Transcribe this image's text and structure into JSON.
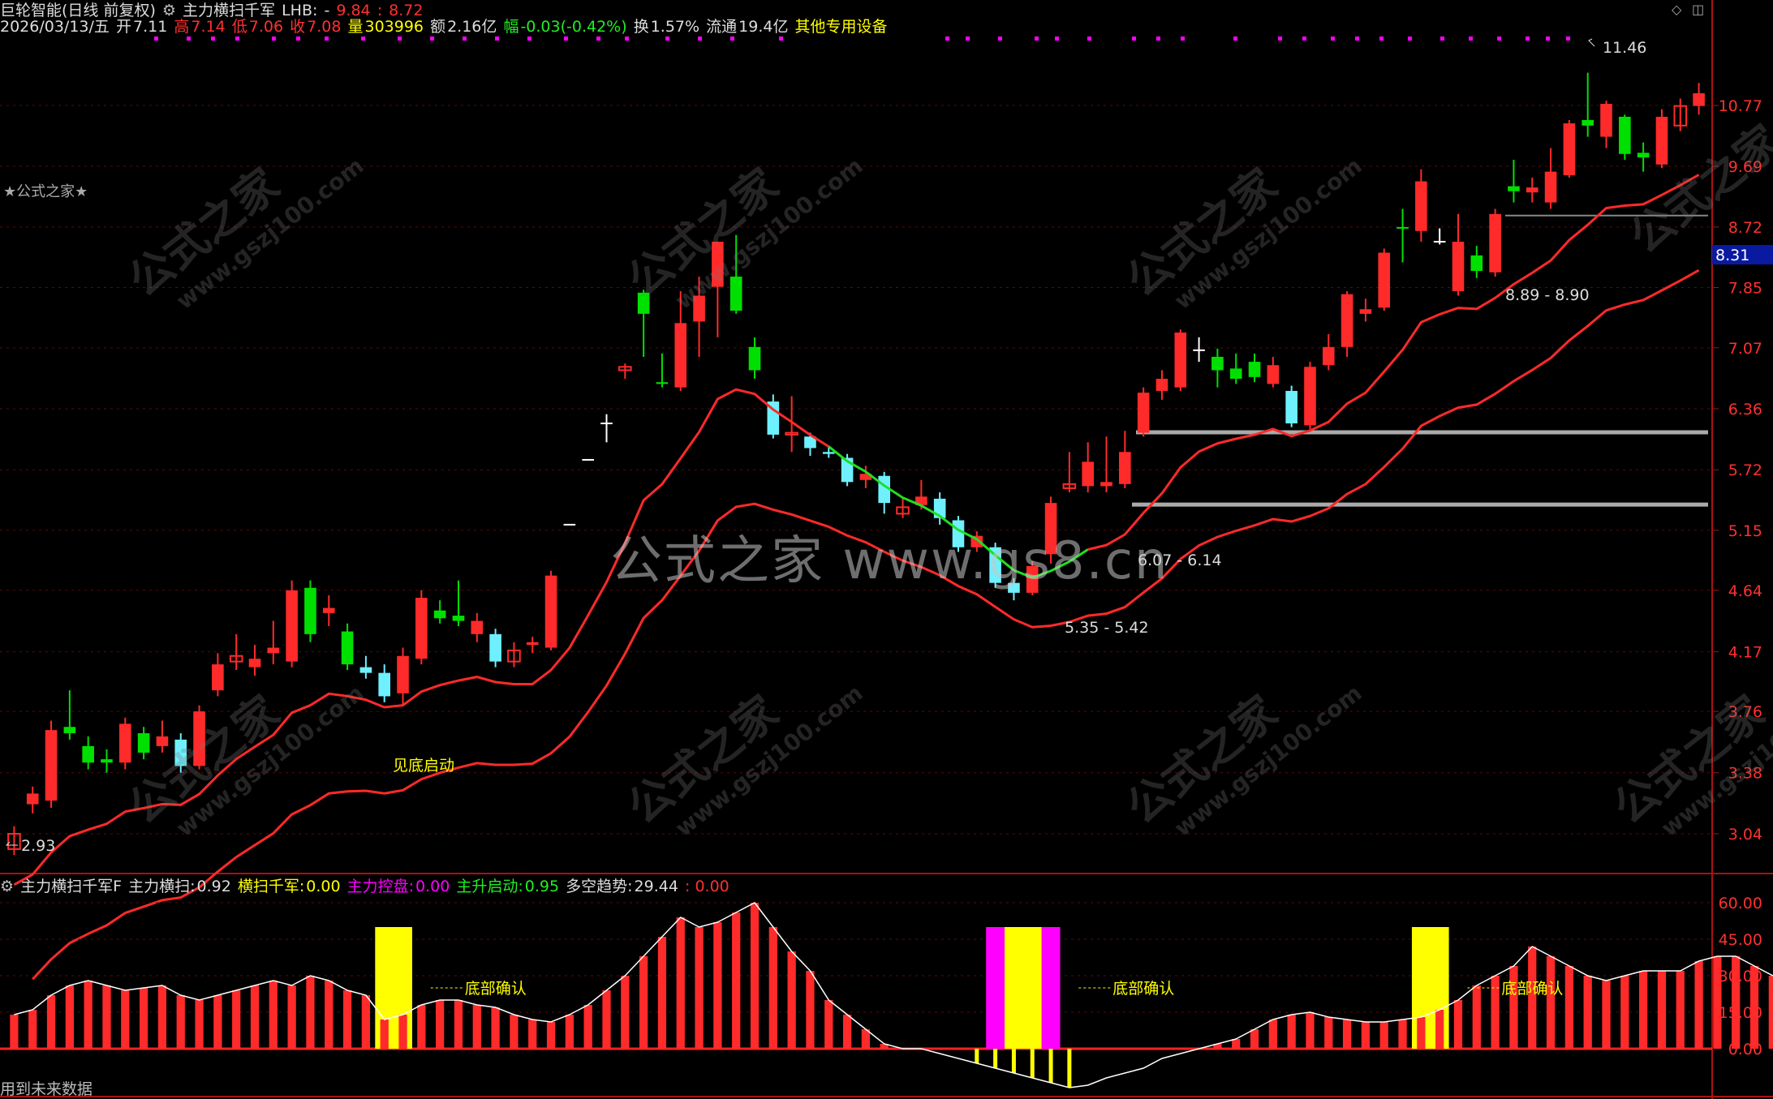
{
  "header": {
    "app": "巨轮智能(日线 前复权)",
    "indicator": "主力横扫千军",
    "lhb_label": "LHB:",
    "lhb_dash": "-",
    "range_a": "9.84",
    "range_b": "8.72"
  },
  "quote": {
    "date": "2026/03/13/五",
    "open_label": "开",
    "open": "7.11",
    "high_label": "高",
    "high": "7.14",
    "low_label": "低",
    "low": "7.06",
    "close_label": "收",
    "close": "7.08",
    "volume_label": "量",
    "volume": "303996",
    "amount_label": "额",
    "amount": "2.16亿",
    "change_label": "幅",
    "change": "-0.03(-0.42%)",
    "turnover_label": "换",
    "turnover": "1.57%",
    "float_label": "流通",
    "float": "19.4亿",
    "device": "其他专用设备"
  },
  "side_tag": "★公式之家★",
  "watermark": {
    "center": "公式之家 www.gs8.cn",
    "brand": "公式之家",
    "url": "www.gszj100.com"
  },
  "price_axis": [
    "10.77",
    "9.69",
    "8.72",
    "7.85",
    "7.07",
    "6.36",
    "5.72",
    "5.15",
    "4.64",
    "4.17",
    "3.76",
    "3.38",
    "3.04"
  ],
  "current_price": "8.31",
  "annotations": {
    "high_mark": "11.46",
    "low_mark": "2.93",
    "zone1": "8.89 - 8.90",
    "zone2": "6.07 - 6.14",
    "zone3": "5.35 - 5.42",
    "signal": "见底启动",
    "bottom_confirm": "底部确认"
  },
  "lower": {
    "title": "主力横扫千军F",
    "l1": "主力横扫:",
    "v1": "0.92",
    "l2": "横扫千军:",
    "v2": "0.00",
    "l3": "主力控盘:",
    "v3": "0.00",
    "l4": "主升启动:",
    "v4": "0.95",
    "l5": "多空趋势:",
    "v5": "29.44",
    "v6": ": 0.00",
    "axis": [
      "60.00",
      "45.00",
      "30.00",
      "15.00",
      "0.00"
    ]
  },
  "footer": "用到未来数据",
  "colors": {
    "up": "#ff2a2a",
    "down_a": "#00e000",
    "down_b": "#6ef0ff",
    "yellow": "#ffff00",
    "magenta": "#ff00ff",
    "green_line": "#22dd22"
  },
  "chart_data": {
    "type": "candlestick",
    "candles": [
      {
        "o": 3.04,
        "c": 2.96,
        "h": 3.08,
        "l": 2.93,
        "k": "r"
      },
      {
        "o": 3.2,
        "c": 3.26,
        "h": 3.3,
        "l": 3.15,
        "k": "r"
      },
      {
        "o": 3.22,
        "c": 3.64,
        "h": 3.7,
        "l": 3.18,
        "k": "r"
      },
      {
        "o": 3.66,
        "c": 3.62,
        "h": 3.9,
        "l": 3.58,
        "k": "g"
      },
      {
        "o": 3.54,
        "c": 3.44,
        "h": 3.6,
        "l": 3.4,
        "k": "g"
      },
      {
        "o": 3.44,
        "c": 3.46,
        "h": 3.52,
        "l": 3.38,
        "k": "g"
      },
      {
        "o": 3.44,
        "c": 3.68,
        "h": 3.72,
        "l": 3.4,
        "k": "r"
      },
      {
        "o": 3.62,
        "c": 3.5,
        "h": 3.66,
        "l": 3.46,
        "k": "g"
      },
      {
        "o": 3.6,
        "c": 3.54,
        "h": 3.7,
        "l": 3.5,
        "k": "r"
      },
      {
        "o": 3.58,
        "c": 3.42,
        "h": 3.62,
        "l": 3.38,
        "k": "c"
      },
      {
        "o": 3.42,
        "c": 3.76,
        "h": 3.8,
        "l": 3.4,
        "k": "r"
      },
      {
        "o": 3.9,
        "c": 4.08,
        "h": 4.16,
        "l": 3.86,
        "k": "r"
      },
      {
        "o": 4.1,
        "c": 4.14,
        "h": 4.3,
        "l": 4.04,
        "k": "r"
      },
      {
        "o": 4.06,
        "c": 4.12,
        "h": 4.22,
        "l": 4.0,
        "k": "r"
      },
      {
        "o": 4.16,
        "c": 4.2,
        "h": 4.4,
        "l": 4.08,
        "k": "r"
      },
      {
        "o": 4.1,
        "c": 4.64,
        "h": 4.72,
        "l": 4.06,
        "k": "r"
      },
      {
        "o": 4.66,
        "c": 4.3,
        "h": 4.72,
        "l": 4.24,
        "k": "g"
      },
      {
        "o": 4.46,
        "c": 4.5,
        "h": 4.6,
        "l": 4.36,
        "k": "r"
      },
      {
        "o": 4.32,
        "c": 4.08,
        "h": 4.38,
        "l": 4.04,
        "k": "g"
      },
      {
        "o": 4.06,
        "c": 4.02,
        "h": 4.14,
        "l": 3.98,
        "k": "c"
      },
      {
        "o": 4.02,
        "c": 3.86,
        "h": 4.08,
        "l": 3.82,
        "k": "c"
      },
      {
        "o": 3.88,
        "c": 4.14,
        "h": 4.2,
        "l": 3.8,
        "k": "r"
      },
      {
        "o": 4.12,
        "c": 4.58,
        "h": 4.64,
        "l": 4.08,
        "k": "r"
      },
      {
        "o": 4.48,
        "c": 4.42,
        "h": 4.56,
        "l": 4.38,
        "k": "g"
      },
      {
        "o": 4.44,
        "c": 4.4,
        "h": 4.72,
        "l": 4.36,
        "k": "g"
      },
      {
        "o": 4.3,
        "c": 4.4,
        "h": 4.46,
        "l": 4.24,
        "k": "r"
      },
      {
        "o": 4.3,
        "c": 4.1,
        "h": 4.34,
        "l": 4.06,
        "k": "c"
      },
      {
        "o": 4.1,
        "c": 4.18,
        "h": 4.24,
        "l": 4.06,
        "k": "r"
      },
      {
        "o": 4.22,
        "c": 4.24,
        "h": 4.28,
        "l": 4.16,
        "k": "r"
      },
      {
        "o": 4.2,
        "c": 4.76,
        "h": 4.8,
        "l": 4.18,
        "k": "r"
      },
      {
        "o": 5.2,
        "c": 5.2,
        "h": 5.2,
        "l": 5.2,
        "k": "w"
      },
      {
        "o": 5.82,
        "c": 5.82,
        "h": 5.82,
        "l": 5.82,
        "k": "w"
      },
      {
        "o": 6.2,
        "c": 6.2,
        "h": 6.3,
        "l": 6.0,
        "k": "w"
      },
      {
        "o": 6.8,
        "c": 6.84,
        "h": 6.88,
        "l": 6.7,
        "k": "r"
      },
      {
        "o": 7.78,
        "c": 7.5,
        "h": 7.82,
        "l": 6.96,
        "k": "g"
      },
      {
        "o": 6.64,
        "c": 6.66,
        "h": 7.0,
        "l": 6.6,
        "k": "g"
      },
      {
        "o": 6.6,
        "c": 7.38,
        "h": 7.8,
        "l": 6.56,
        "k": "r"
      },
      {
        "o": 7.4,
        "c": 7.74,
        "h": 8.0,
        "l": 6.96,
        "k": "r"
      },
      {
        "o": 7.86,
        "c": 8.5,
        "h": 8.5,
        "l": 7.2,
        "k": "r"
      },
      {
        "o": 8.0,
        "c": 7.54,
        "h": 8.6,
        "l": 7.5,
        "k": "g"
      },
      {
        "o": 7.08,
        "c": 6.8,
        "h": 7.2,
        "l": 6.7,
        "k": "g"
      },
      {
        "o": 6.44,
        "c": 6.08,
        "h": 6.52,
        "l": 6.04,
        "k": "c"
      },
      {
        "o": 6.08,
        "c": 6.1,
        "h": 6.5,
        "l": 5.9,
        "k": "r"
      },
      {
        "o": 6.06,
        "c": 5.94,
        "h": 6.1,
        "l": 5.86,
        "k": "c"
      },
      {
        "o": 5.9,
        "c": 5.88,
        "h": 5.96,
        "l": 5.84,
        "k": "c"
      },
      {
        "o": 5.84,
        "c": 5.6,
        "h": 5.88,
        "l": 5.56,
        "k": "c"
      },
      {
        "o": 5.62,
        "c": 5.68,
        "h": 5.76,
        "l": 5.54,
        "k": "r"
      },
      {
        "o": 5.66,
        "c": 5.4,
        "h": 5.7,
        "l": 5.3,
        "k": "c"
      },
      {
        "o": 5.3,
        "c": 5.36,
        "h": 5.44,
        "l": 5.26,
        "k": "r"
      },
      {
        "o": 5.38,
        "c": 5.46,
        "h": 5.62,
        "l": 5.34,
        "k": "r"
      },
      {
        "o": 5.44,
        "c": 5.26,
        "h": 5.5,
        "l": 5.2,
        "k": "c"
      },
      {
        "o": 5.24,
        "c": 5.0,
        "h": 5.28,
        "l": 4.96,
        "k": "c"
      },
      {
        "o": 5.0,
        "c": 5.1,
        "h": 5.14,
        "l": 4.96,
        "k": "r"
      },
      {
        "o": 5.0,
        "c": 4.7,
        "h": 5.04,
        "l": 4.66,
        "k": "c"
      },
      {
        "o": 4.7,
        "c": 4.62,
        "h": 4.74,
        "l": 4.56,
        "k": "c"
      },
      {
        "o": 4.62,
        "c": 4.84,
        "h": 4.88,
        "l": 4.6,
        "k": "r"
      },
      {
        "o": 4.94,
        "c": 5.4,
        "h": 5.46,
        "l": 4.86,
        "k": "r"
      },
      {
        "o": 5.54,
        "c": 5.58,
        "h": 5.9,
        "l": 5.5,
        "k": "r"
      },
      {
        "o": 5.56,
        "c": 5.8,
        "h": 6.0,
        "l": 5.5,
        "k": "r"
      },
      {
        "o": 5.6,
        "c": 5.56,
        "h": 6.06,
        "l": 5.5,
        "k": "r"
      },
      {
        "o": 5.58,
        "c": 5.9,
        "h": 6.12,
        "l": 5.54,
        "k": "r"
      },
      {
        "o": 6.1,
        "c": 6.54,
        "h": 6.6,
        "l": 6.06,
        "k": "r"
      },
      {
        "o": 6.56,
        "c": 6.7,
        "h": 6.8,
        "l": 6.46,
        "k": "r"
      },
      {
        "o": 6.6,
        "c": 7.26,
        "h": 7.3,
        "l": 6.56,
        "k": "r"
      },
      {
        "o": 7.0,
        "c": 7.04,
        "h": 7.2,
        "l": 6.9,
        "k": "w"
      },
      {
        "o": 6.96,
        "c": 6.8,
        "h": 7.06,
        "l": 6.6,
        "k": "g"
      },
      {
        "o": 6.82,
        "c": 6.7,
        "h": 7.0,
        "l": 6.64,
        "k": "g"
      },
      {
        "o": 6.9,
        "c": 6.72,
        "h": 7.0,
        "l": 6.66,
        "k": "g"
      },
      {
        "o": 6.64,
        "c": 6.86,
        "h": 6.96,
        "l": 6.6,
        "k": "r"
      },
      {
        "o": 6.56,
        "c": 6.2,
        "h": 6.62,
        "l": 6.16,
        "k": "c"
      },
      {
        "o": 6.18,
        "c": 6.84,
        "h": 6.9,
        "l": 6.14,
        "k": "r"
      },
      {
        "o": 6.86,
        "c": 7.08,
        "h": 7.24,
        "l": 6.8,
        "k": "r"
      },
      {
        "o": 7.08,
        "c": 7.76,
        "h": 7.8,
        "l": 6.96,
        "k": "r"
      },
      {
        "o": 7.5,
        "c": 7.56,
        "h": 7.7,
        "l": 7.4,
        "k": "r"
      },
      {
        "o": 7.58,
        "c": 8.34,
        "h": 8.4,
        "l": 7.54,
        "k": "r"
      },
      {
        "o": 8.72,
        "c": 8.7,
        "h": 9.0,
        "l": 8.2,
        "k": "g"
      },
      {
        "o": 8.66,
        "c": 9.44,
        "h": 9.64,
        "l": 8.5,
        "k": "r"
      },
      {
        "o": 8.5,
        "c": 8.5,
        "h": 8.7,
        "l": 8.46,
        "k": "w"
      },
      {
        "o": 7.8,
        "c": 8.5,
        "h": 8.92,
        "l": 7.74,
        "k": "r"
      },
      {
        "o": 8.3,
        "c": 8.08,
        "h": 8.44,
        "l": 7.98,
        "k": "g"
      },
      {
        "o": 8.06,
        "c": 8.92,
        "h": 9.0,
        "l": 8.0,
        "k": "r"
      },
      {
        "o": 9.36,
        "c": 9.28,
        "h": 9.8,
        "l": 9.1,
        "k": "g"
      },
      {
        "o": 9.26,
        "c": 9.34,
        "h": 9.5,
        "l": 9.1,
        "k": "r"
      },
      {
        "o": 9.1,
        "c": 9.6,
        "h": 10.0,
        "l": 9.0,
        "k": "r"
      },
      {
        "o": 9.54,
        "c": 10.44,
        "h": 10.5,
        "l": 9.5,
        "k": "r"
      },
      {
        "o": 10.5,
        "c": 10.4,
        "h": 11.4,
        "l": 10.2,
        "k": "g"
      },
      {
        "o": 10.2,
        "c": 10.8,
        "h": 10.86,
        "l": 10.0,
        "k": "r"
      },
      {
        "o": 10.56,
        "c": 9.9,
        "h": 10.6,
        "l": 9.8,
        "k": "g"
      },
      {
        "o": 9.92,
        "c": 9.84,
        "h": 10.1,
        "l": 9.6,
        "k": "g"
      },
      {
        "o": 9.72,
        "c": 10.56,
        "h": 10.7,
        "l": 9.66,
        "k": "r"
      },
      {
        "o": 10.4,
        "c": 10.76,
        "h": 10.9,
        "l": 10.3,
        "k": "r"
      },
      {
        "o": 10.76,
        "c": 11.0,
        "h": 11.2,
        "l": 10.6,
        "k": "r"
      }
    ],
    "lower_values": [
      14,
      16,
      22,
      26,
      28,
      26,
      24,
      25,
      26,
      22,
      20,
      22,
      24,
      26,
      28,
      26,
      30,
      28,
      24,
      22,
      12,
      14,
      18,
      20,
      20,
      18,
      17,
      14,
      12,
      11,
      14,
      18,
      24,
      30,
      38,
      46,
      54,
      50,
      52,
      56,
      60,
      50,
      40,
      32,
      20,
      14,
      8,
      2,
      0,
      0,
      -2,
      -4,
      -6,
      -8,
      -10,
      -12,
      -14,
      -16,
      -15,
      -12,
      -10,
      -8,
      -4,
      -2,
      0,
      2,
      4,
      8,
      12,
      14,
      15,
      13,
      12,
      11,
      11,
      12,
      13,
      16,
      20,
      26,
      30,
      34,
      42,
      38,
      34,
      30,
      28,
      30,
      32,
      32,
      32,
      36,
      38,
      38,
      34,
      30,
      28,
      29,
      29
    ]
  }
}
